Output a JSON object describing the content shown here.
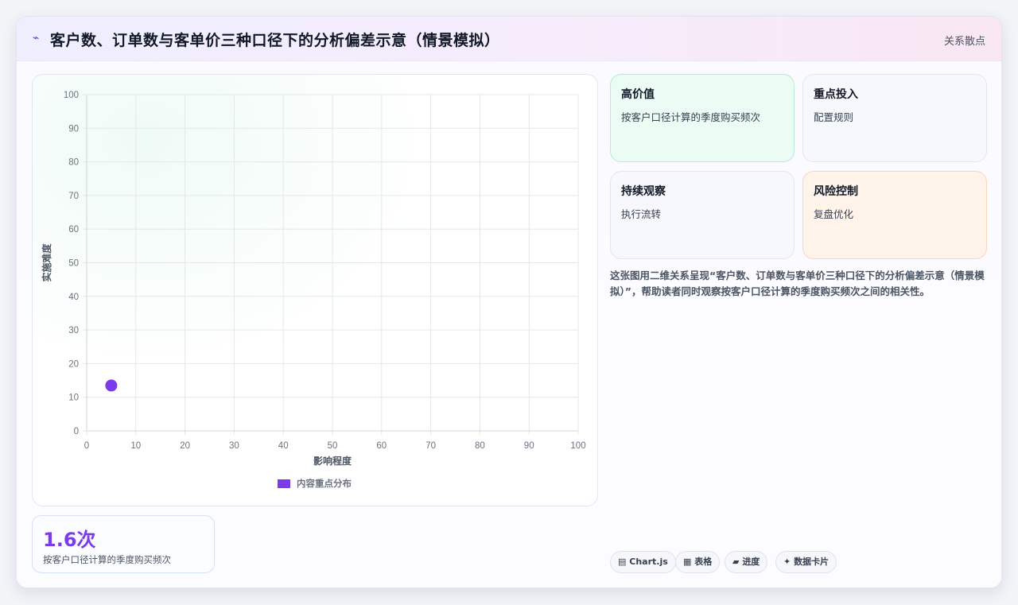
{
  "header": {
    "icon": "lightning-icon",
    "title": "客户数、订单数与客单价三种口径下的分析偏差示意（情景模拟）",
    "tag": "关系散点"
  },
  "chart_data": {
    "type": "scatter",
    "xlabel": "影响程度",
    "ylabel": "实施难度",
    "xlim": [
      0,
      100
    ],
    "ylim": [
      0,
      100
    ],
    "xticks": [
      0,
      10,
      20,
      30,
      40,
      50,
      60,
      70,
      80,
      90,
      100
    ],
    "yticks": [
      0,
      10,
      20,
      30,
      40,
      50,
      60,
      70,
      80,
      90,
      100
    ],
    "grid": true,
    "legend_position": "bottom",
    "series": [
      {
        "name": "内容重点分布",
        "color": "#7c3aed",
        "points": [
          {
            "x": 5,
            "y": 13.5
          }
        ]
      }
    ]
  },
  "quadrants": [
    {
      "title": "高价值",
      "subtitle": "按客户口径计算的季度购买频次"
    },
    {
      "title": "重点投入",
      "subtitle": "配置规则"
    },
    {
      "title": "持续观察",
      "subtitle": "执行流转"
    },
    {
      "title": "风险控制",
      "subtitle": "复盘优化"
    }
  ],
  "description": "这张图用二维关系呈现“客户数、订单数与客单价三种口径下的分析偏差示意（情景模拟）”，帮助读者同时观察按客户口径计算的季度购买频次之间的相关性。",
  "stat": {
    "value": "1.6次",
    "label": "按客户口径计算的季度购买频次"
  },
  "chips": [
    {
      "icon": "chart-icon",
      "glyph": "▤",
      "label": "Chart.js"
    },
    {
      "icon": "table-icon",
      "glyph": "▦",
      "label": "表格"
    },
    {
      "icon": "progress-icon",
      "glyph": "▰",
      "label": "进度"
    },
    {
      "icon": "sparkle-icon",
      "glyph": "✦",
      "label": "数据卡片"
    }
  ]
}
